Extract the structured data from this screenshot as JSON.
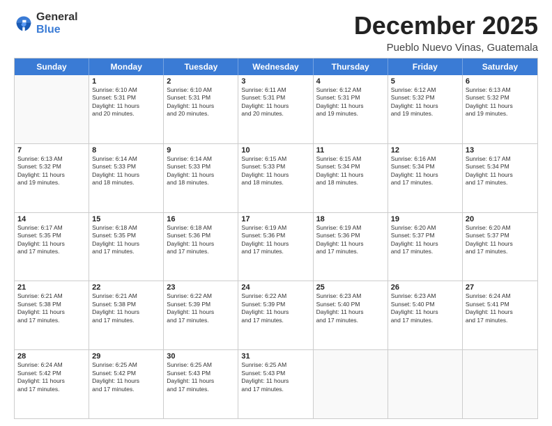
{
  "header": {
    "logo_general": "General",
    "logo_blue": "Blue",
    "month_title": "December 2025",
    "subtitle": "Pueblo Nuevo Vinas, Guatemala"
  },
  "weekdays": [
    "Sunday",
    "Monday",
    "Tuesday",
    "Wednesday",
    "Thursday",
    "Friday",
    "Saturday"
  ],
  "rows": [
    [
      {
        "day": "",
        "info": ""
      },
      {
        "day": "1",
        "info": "Sunrise: 6:10 AM\nSunset: 5:31 PM\nDaylight: 11 hours\nand 20 minutes."
      },
      {
        "day": "2",
        "info": "Sunrise: 6:10 AM\nSunset: 5:31 PM\nDaylight: 11 hours\nand 20 minutes."
      },
      {
        "day": "3",
        "info": "Sunrise: 6:11 AM\nSunset: 5:31 PM\nDaylight: 11 hours\nand 20 minutes."
      },
      {
        "day": "4",
        "info": "Sunrise: 6:12 AM\nSunset: 5:31 PM\nDaylight: 11 hours\nand 19 minutes."
      },
      {
        "day": "5",
        "info": "Sunrise: 6:12 AM\nSunset: 5:32 PM\nDaylight: 11 hours\nand 19 minutes."
      },
      {
        "day": "6",
        "info": "Sunrise: 6:13 AM\nSunset: 5:32 PM\nDaylight: 11 hours\nand 19 minutes."
      }
    ],
    [
      {
        "day": "7",
        "info": "Sunrise: 6:13 AM\nSunset: 5:32 PM\nDaylight: 11 hours\nand 19 minutes."
      },
      {
        "day": "8",
        "info": "Sunrise: 6:14 AM\nSunset: 5:33 PM\nDaylight: 11 hours\nand 18 minutes."
      },
      {
        "day": "9",
        "info": "Sunrise: 6:14 AM\nSunset: 5:33 PM\nDaylight: 11 hours\nand 18 minutes."
      },
      {
        "day": "10",
        "info": "Sunrise: 6:15 AM\nSunset: 5:33 PM\nDaylight: 11 hours\nand 18 minutes."
      },
      {
        "day": "11",
        "info": "Sunrise: 6:15 AM\nSunset: 5:34 PM\nDaylight: 11 hours\nand 18 minutes."
      },
      {
        "day": "12",
        "info": "Sunrise: 6:16 AM\nSunset: 5:34 PM\nDaylight: 11 hours\nand 17 minutes."
      },
      {
        "day": "13",
        "info": "Sunrise: 6:17 AM\nSunset: 5:34 PM\nDaylight: 11 hours\nand 17 minutes."
      }
    ],
    [
      {
        "day": "14",
        "info": "Sunrise: 6:17 AM\nSunset: 5:35 PM\nDaylight: 11 hours\nand 17 minutes."
      },
      {
        "day": "15",
        "info": "Sunrise: 6:18 AM\nSunset: 5:35 PM\nDaylight: 11 hours\nand 17 minutes."
      },
      {
        "day": "16",
        "info": "Sunrise: 6:18 AM\nSunset: 5:36 PM\nDaylight: 11 hours\nand 17 minutes."
      },
      {
        "day": "17",
        "info": "Sunrise: 6:19 AM\nSunset: 5:36 PM\nDaylight: 11 hours\nand 17 minutes."
      },
      {
        "day": "18",
        "info": "Sunrise: 6:19 AM\nSunset: 5:36 PM\nDaylight: 11 hours\nand 17 minutes."
      },
      {
        "day": "19",
        "info": "Sunrise: 6:20 AM\nSunset: 5:37 PM\nDaylight: 11 hours\nand 17 minutes."
      },
      {
        "day": "20",
        "info": "Sunrise: 6:20 AM\nSunset: 5:37 PM\nDaylight: 11 hours\nand 17 minutes."
      }
    ],
    [
      {
        "day": "21",
        "info": "Sunrise: 6:21 AM\nSunset: 5:38 PM\nDaylight: 11 hours\nand 17 minutes."
      },
      {
        "day": "22",
        "info": "Sunrise: 6:21 AM\nSunset: 5:38 PM\nDaylight: 11 hours\nand 17 minutes."
      },
      {
        "day": "23",
        "info": "Sunrise: 6:22 AM\nSunset: 5:39 PM\nDaylight: 11 hours\nand 17 minutes."
      },
      {
        "day": "24",
        "info": "Sunrise: 6:22 AM\nSunset: 5:39 PM\nDaylight: 11 hours\nand 17 minutes."
      },
      {
        "day": "25",
        "info": "Sunrise: 6:23 AM\nSunset: 5:40 PM\nDaylight: 11 hours\nand 17 minutes."
      },
      {
        "day": "26",
        "info": "Sunrise: 6:23 AM\nSunset: 5:40 PM\nDaylight: 11 hours\nand 17 minutes."
      },
      {
        "day": "27",
        "info": "Sunrise: 6:24 AM\nSunset: 5:41 PM\nDaylight: 11 hours\nand 17 minutes."
      }
    ],
    [
      {
        "day": "28",
        "info": "Sunrise: 6:24 AM\nSunset: 5:42 PM\nDaylight: 11 hours\nand 17 minutes."
      },
      {
        "day": "29",
        "info": "Sunrise: 6:25 AM\nSunset: 5:42 PM\nDaylight: 11 hours\nand 17 minutes."
      },
      {
        "day": "30",
        "info": "Sunrise: 6:25 AM\nSunset: 5:43 PM\nDaylight: 11 hours\nand 17 minutes."
      },
      {
        "day": "31",
        "info": "Sunrise: 6:25 AM\nSunset: 5:43 PM\nDaylight: 11 hours\nand 17 minutes."
      },
      {
        "day": "",
        "info": ""
      },
      {
        "day": "",
        "info": ""
      },
      {
        "day": "",
        "info": ""
      }
    ]
  ]
}
